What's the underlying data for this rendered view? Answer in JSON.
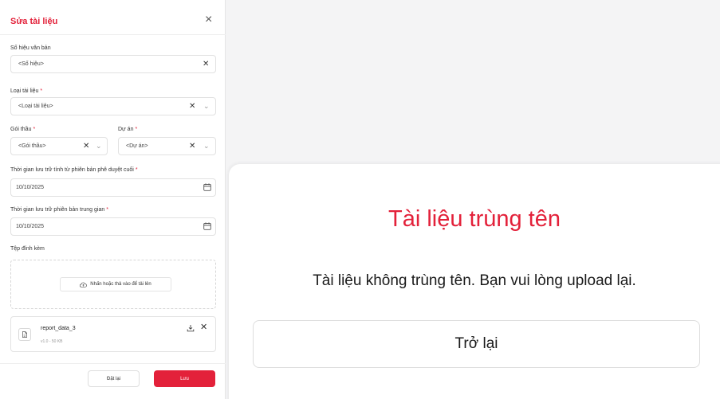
{
  "form": {
    "title": "Sửa tài liệu",
    "fields": {
      "document_number": {
        "label": "Số hiệu văn bản",
        "placeholder": "<Số hiệu>"
      },
      "document_type": {
        "label": "Loại tài liệu",
        "placeholder": "<Loại tài liệu>"
      },
      "package": {
        "label": "Gói thầu",
        "placeholder": "<Gói thầu>"
      },
      "project": {
        "label": "Dự án",
        "placeholder": "<Dự án>"
      },
      "retention_final": {
        "label": "Thời gian lưu trữ tính từ phiên bản phê duyệt cuối",
        "value": "10/10/2025"
      },
      "retention_intermediate": {
        "label": "Thời gian lưu trữ phiên bản trung gian",
        "value": "10/10/2025"
      }
    },
    "required_mark": "*",
    "attachments": {
      "label": "Tệp đính kèm",
      "upload_text": "Nhấn hoặc thả vào để tải lên",
      "file": {
        "name": "report_data_3",
        "meta": "v1.0 - 50 KB"
      }
    },
    "buttons": {
      "reset": "Đặt lại",
      "save": "Lưu"
    }
  },
  "dialog": {
    "title": "Tài liệu trùng tên",
    "message": "Tài liệu không trùng tên. Bạn vui lòng upload lại.",
    "back_label": "Trở lại"
  },
  "icons": {
    "close": "close-icon",
    "clear": "clear-icon",
    "chevron": "chevron-down-icon",
    "calendar": "calendar-icon",
    "upload": "cloud-upload-icon",
    "file": "file-icon",
    "download": "download-icon"
  },
  "colors": {
    "accent": "#e3213a",
    "border": "#e1e1e1"
  }
}
